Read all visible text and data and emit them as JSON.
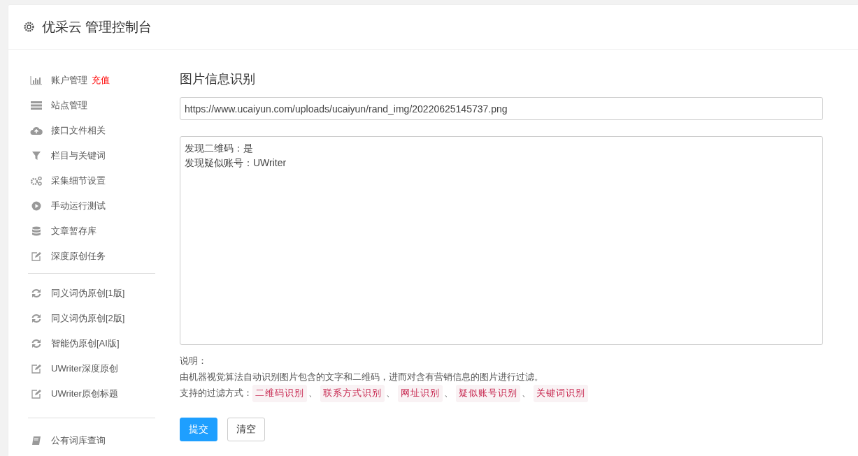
{
  "header": {
    "title": "优采云 管理控制台"
  },
  "sidebar": {
    "groups": [
      [
        {
          "label": "账户管理",
          "badge": "充值"
        },
        {
          "label": "站点管理"
        },
        {
          "label": "接口文件相关"
        },
        {
          "label": "栏目与关键词"
        },
        {
          "label": "采集细节设置"
        },
        {
          "label": "手动运行测试"
        },
        {
          "label": "文章暂存库"
        },
        {
          "label": "深度原创任务"
        }
      ],
      [
        {
          "label": "同义词伪原创[1版]"
        },
        {
          "label": "同义词伪原创[2版]"
        },
        {
          "label": "智能伪原创[AI版]"
        },
        {
          "label": "UWriter深度原创"
        },
        {
          "label": "UWriter原创标题"
        }
      ],
      [
        {
          "label": "公有词库查询"
        }
      ]
    ]
  },
  "panel": {
    "title": "图片信息识别",
    "url_field": {
      "value": "https://www.ucaiyun.com/uploads/ucaiyun/rand_img/20220625145737.png"
    },
    "result_field": {
      "lines": [
        "发现二维码：是",
        "发现疑似账号：UWriter"
      ]
    },
    "notes": {
      "heading": "说明：",
      "description": "由机器视觉算法自动识别图片包含的文字和二维码，进而对含有营销信息的图片进行过滤。",
      "filter_label": "支持的过滤方式：",
      "separator": "、",
      "tags": [
        "二维码识别",
        "联系方式识别",
        "网址识别",
        "疑似账号识别",
        "关键词识别"
      ]
    },
    "buttons": [
      {
        "label": "提交",
        "kind": "primary"
      },
      {
        "label": "清空",
        "kind": "default"
      }
    ]
  }
}
